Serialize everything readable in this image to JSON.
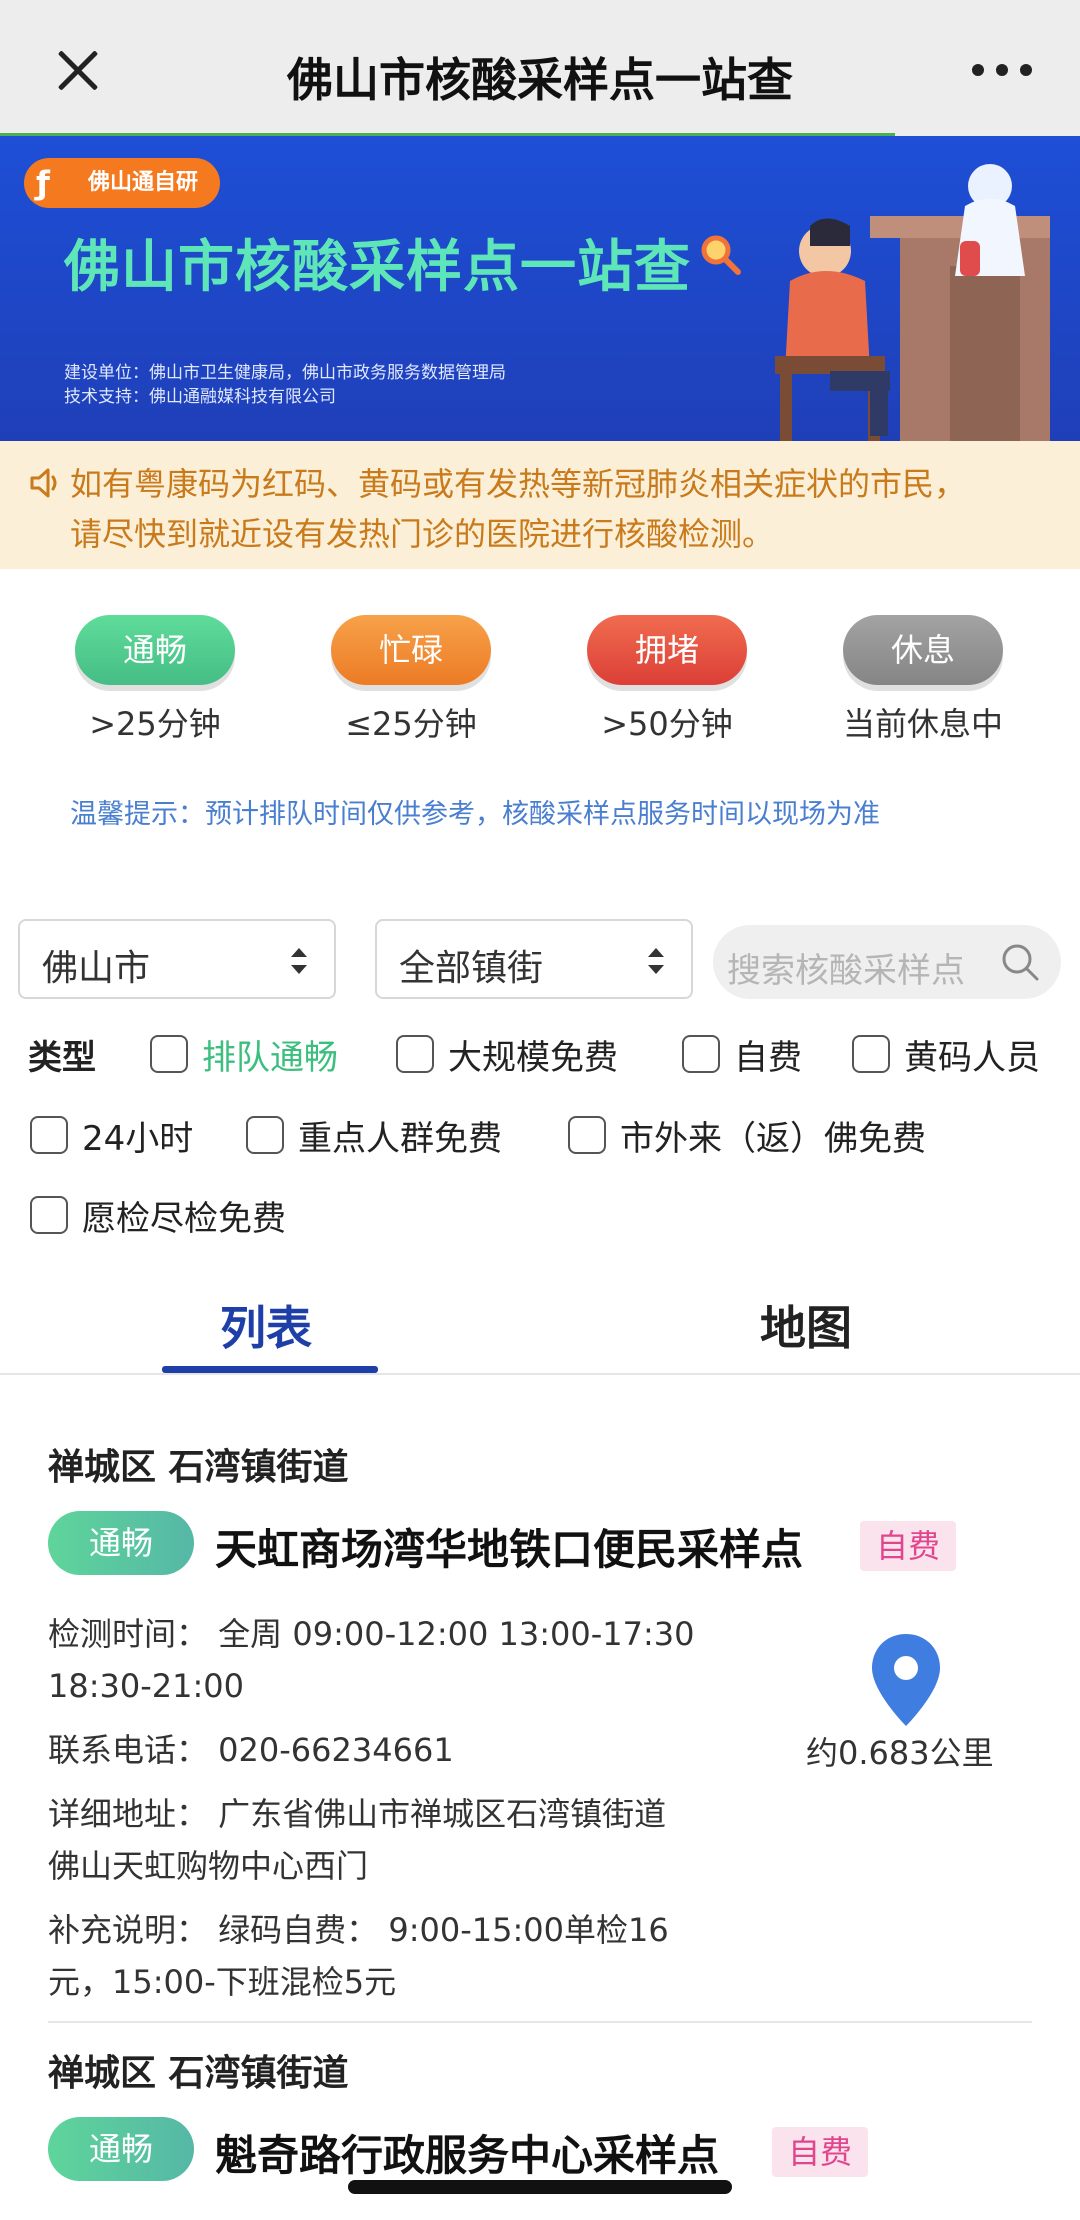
{
  "navbar": {
    "title": "佛山市核酸采样点一站查"
  },
  "banner": {
    "brand_tag": "佛山通自研",
    "title": "佛山市核酸采样点一站查",
    "credit_builder": "建设单位：佛山市卫生健康局，佛山市政务服务数据管理局",
    "credit_tech": "技术支持：佛山通融媒科技有限公司"
  },
  "notice": {
    "line1": "如有粤康码为红码、黄码或有发热等新冠肺炎相关症状的市民，",
    "line2": "请尽快到就近设有发热门诊的医院进行核酸检测。"
  },
  "legend": [
    {
      "label": "通畅",
      "sub": ">25分钟",
      "color": "#4fcf8e"
    },
    {
      "label": "忙碌",
      "sub": "≤25分钟",
      "color": "#f08b2e"
    },
    {
      "label": "拥堵",
      "sub": ">50分钟",
      "color": "#e8523e"
    },
    {
      "label": "休息",
      "sub": "当前休息中",
      "color": "#8f8f8f"
    }
  ],
  "tip": "温馨提示：预计排队时间仅供参考，核酸采样点服务时间以现场为准",
  "filters": {
    "city": "佛山市",
    "town": "全部镇街",
    "search_placeholder": "搜索核酸采样点",
    "type_label": "类型",
    "options": [
      "排队通畅",
      "大规模免费",
      "自费",
      "黄码人员",
      "24小时",
      "重点人群免费",
      "市外来（返）佛免费",
      "愿检尽检免费"
    ]
  },
  "tabs": {
    "list": "列表",
    "map": "地图"
  },
  "sites": [
    {
      "area": "禅城区 石湾镇街道",
      "status": "通畅",
      "name": "天虹商场湾华地铁口便民采样点",
      "fee": "自费",
      "hours_1": "检测时间：  全周 09:00-12:00 13:00-17:30",
      "hours_2": "18:30-21:00",
      "phone": "联系电话：  020-66234661",
      "address_1": "详细地址：  广东省佛山市禅城区石湾镇街道",
      "address_2": "佛山天虹购物中心西门",
      "note_1": "补充说明：  绿码自费：  9:00-15:00单检16",
      "note_2": "元，15:00-下班混检5元",
      "distance": "约0.683公里"
    },
    {
      "area": "禅城区 石湾镇街道",
      "status": "通畅",
      "name": "魁奇路行政服务中心采样点",
      "fee": "自费"
    }
  ]
}
